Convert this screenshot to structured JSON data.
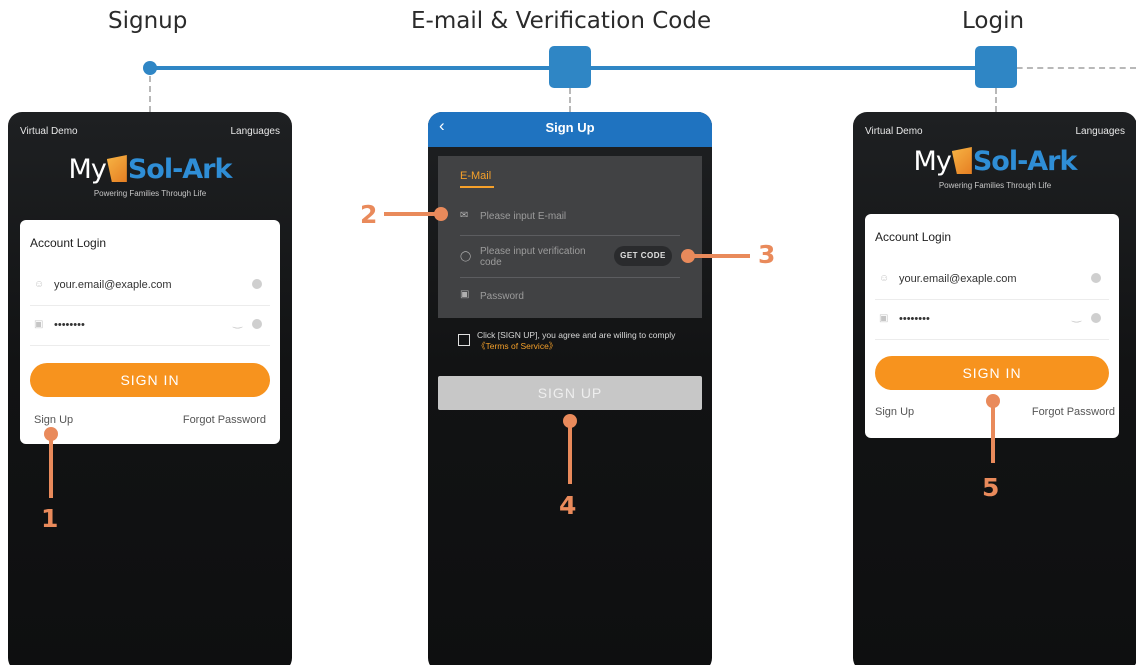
{
  "steps": {
    "signup": "Signup",
    "verification": "E-mail & Verification Code",
    "login": "Login"
  },
  "brand": {
    "name_left": "My",
    "name_right": "Sol-Ark",
    "tagline": "Powering Families Through Life",
    "accent_blue": "#2f86c5",
    "accent_orange": "#f7931e",
    "annotation_color": "#e98a5b"
  },
  "login_screen": {
    "virtual_demo": "Virtual Demo",
    "languages": "Languages",
    "card_title": "Account Login",
    "email_value": "your.email@exaple.com",
    "password_value": "••••••••",
    "sign_in": "SIGN IN",
    "sign_up": "Sign Up",
    "forgot_password": "Forgot Password"
  },
  "signup_screen": {
    "back_icon": "chevron-left-icon",
    "title": "Sign Up",
    "tab_email": "E-Mail",
    "email_placeholder": "Please input E-mail",
    "code_placeholder": "Please input verification code",
    "get_code": "GET CODE",
    "password_placeholder": "Password",
    "agreement_text": "Click [SIGN UP], you agree and are willing to comply",
    "terms_link": "《Terms of Service》",
    "sign_up_button": "SIGN UP"
  },
  "annotations": {
    "n1": "1",
    "n2": "2",
    "n3": "3",
    "n4": "4",
    "n5": "5"
  }
}
